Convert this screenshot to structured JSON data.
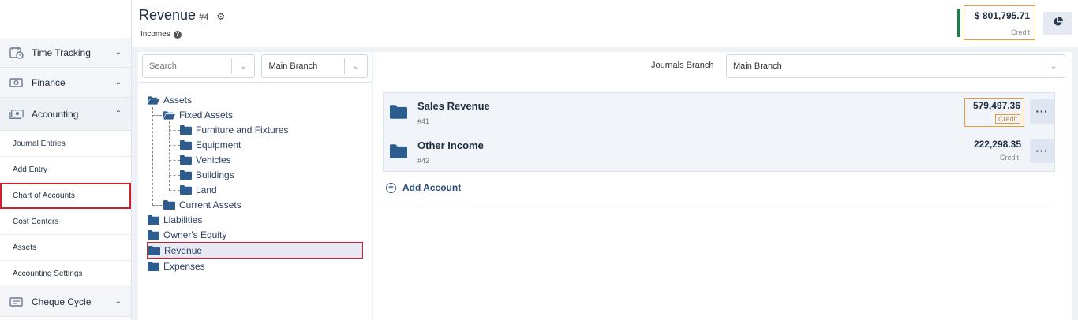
{
  "sidebar": {
    "time_tracking": "Time Tracking",
    "finance": "Finance",
    "accounting": "Accounting",
    "accounting_items": [
      {
        "label": "Journal Entries"
      },
      {
        "label": "Add Entry"
      },
      {
        "label": "Chart of Accounts"
      },
      {
        "label": "Cost Centers"
      },
      {
        "label": "Assets"
      },
      {
        "label": "Accounting Settings"
      }
    ],
    "cheque_cycle": "Cheque Cycle"
  },
  "header": {
    "title": "Revenue",
    "title_number": "#4",
    "subtitle": "Incomes",
    "total_amount": "$ 801,795.71",
    "total_type": "Credit"
  },
  "left_panel": {
    "search_placeholder": "Search",
    "branch": "Main Branch"
  },
  "tree": {
    "assets": "Assets",
    "fixed_assets": "Fixed Assets",
    "furniture": "Furniture and Fixtures",
    "equipment": "Equipment",
    "vehicles": "Vehicles",
    "buildings": "Buildings",
    "land": "Land",
    "current_assets": "Current Assets",
    "liabilities": "Liabilities",
    "owners_equity": "Owner's Equity",
    "revenue": "Revenue",
    "expenses": "Expenses"
  },
  "right_panel": {
    "journals_branch_label": "Journals Branch",
    "journals_branch_value": "Main Branch",
    "accounts": [
      {
        "name": "Sales Revenue",
        "number": "#41",
        "amount": "579,497.36",
        "type": "Credit"
      },
      {
        "name": "Other Income",
        "number": "#42",
        "amount": "222,298.35",
        "type": "Credit"
      }
    ],
    "add_account": "Add Account"
  },
  "colors": {
    "accent_red": "#d21f2b",
    "highlight_orange": "#e39b3b",
    "folder_blue": "#2d5c8f",
    "balance_green": "#1e7d4f"
  }
}
